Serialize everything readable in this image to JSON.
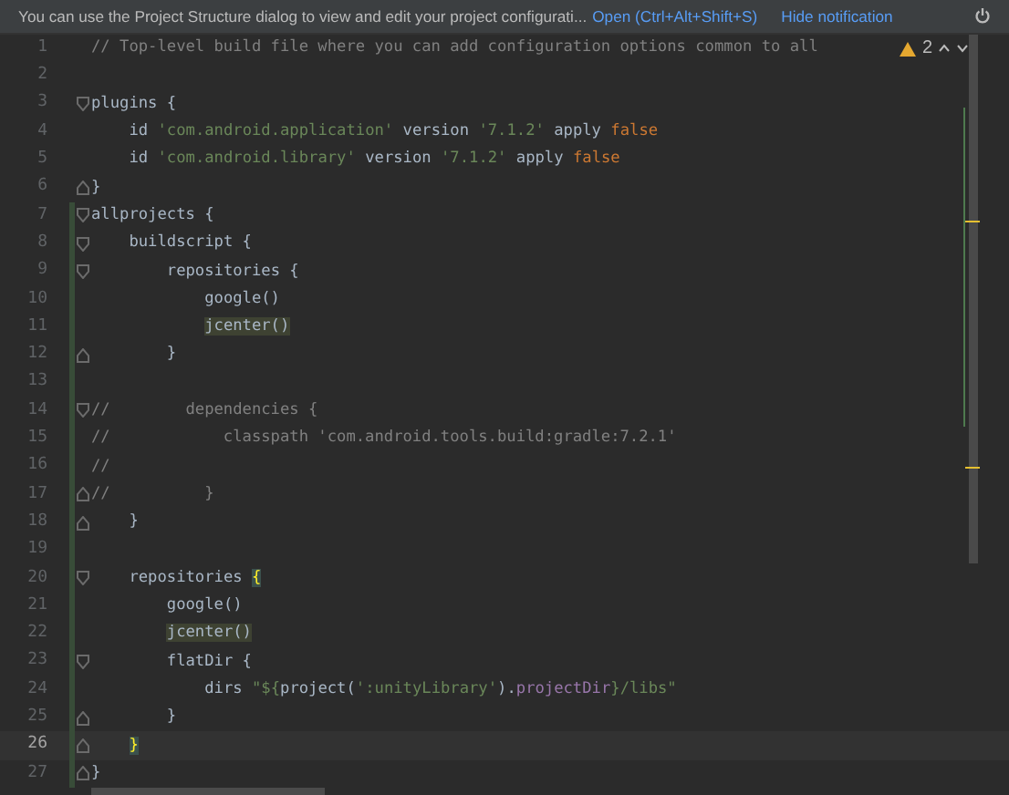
{
  "notification": {
    "text": "You can use the Project Structure dialog to view and edit your project configurati...",
    "actions": [
      {
        "label": "Open (Ctrl+Alt+Shift+S)"
      },
      {
        "label": "Hide notification"
      }
    ]
  },
  "inspections": {
    "count": "2"
  },
  "lines": [
    {
      "number": "1",
      "changed": false,
      "current": false,
      "fold_start": false,
      "fold_end": false,
      "tokens": [
        {
          "text": "// Top-level build file where you can add configuration options common to all",
          "kind": "comment"
        }
      ]
    },
    {
      "number": "2",
      "changed": false,
      "current": false,
      "fold_start": false,
      "fold_end": false
    },
    {
      "number": "3",
      "changed": false,
      "current": false,
      "fold_start": true,
      "fold_end": false,
      "tokens": [
        {
          "text": "plugins {",
          "kind": "plain"
        }
      ]
    },
    {
      "number": "4",
      "changed": false,
      "current": false,
      "fold_start": false,
      "fold_end": false,
      "tokens": [
        {
          "text": "    id",
          "kind": "plain"
        },
        {
          "text": " 'com.android.application'",
          "kind": "string"
        },
        {
          "text": " version",
          "kind": "plain"
        },
        {
          "text": " '7.1.2'",
          "kind": "string"
        },
        {
          "text": " apply",
          "kind": "plain"
        },
        {
          "text": " false",
          "kind": "keyword"
        }
      ]
    },
    {
      "number": "5",
      "changed": false,
      "current": false,
      "fold_start": false,
      "fold_end": false,
      "tokens": [
        {
          "text": "    id",
          "kind": "plain"
        },
        {
          "text": " 'com.android.library'",
          "kind": "string"
        },
        {
          "text": " version",
          "kind": "plain"
        },
        {
          "text": " '7.1.2'",
          "kind": "string"
        },
        {
          "text": " apply",
          "kind": "plain"
        },
        {
          "text": " false",
          "kind": "keyword"
        }
      ]
    },
    {
      "number": "6",
      "changed": false,
      "current": false,
      "fold_start": false,
      "fold_end": true,
      "tokens": [
        {
          "text": "}",
          "kind": "plain"
        }
      ]
    },
    {
      "number": "7",
      "changed": true,
      "current": false,
      "fold_start": true,
      "fold_end": false,
      "tokens": [
        {
          "text": "allprojects {",
          "kind": "plain"
        }
      ]
    },
    {
      "number": "8",
      "changed": true,
      "current": false,
      "fold_start": true,
      "fold_end": false,
      "tokens": [
        {
          "text": "    buildscript {",
          "kind": "plain"
        }
      ]
    },
    {
      "number": "9",
      "changed": true,
      "current": false,
      "fold_start": true,
      "fold_end": false,
      "tokens": [
        {
          "text": "        repositories {",
          "kind": "plain"
        }
      ]
    },
    {
      "number": "10",
      "changed": true,
      "current": false,
      "fold_start": false,
      "fold_end": false,
      "tokens": [
        {
          "text": "            google()",
          "kind": "plain"
        }
      ]
    },
    {
      "number": "11",
      "changed": true,
      "current": false,
      "fold_start": false,
      "fold_end": false,
      "tokens": [
        {
          "text": "            jcenter()",
          "kind": "highlight"
        }
      ]
    },
    {
      "number": "12",
      "changed": true,
      "current": false,
      "fold_start": false,
      "fold_end": true,
      "tokens": [
        {
          "text": "        }",
          "kind": "plain"
        }
      ]
    },
    {
      "number": "13",
      "changed": true,
      "current": false,
      "fold_start": false,
      "fold_end": false
    },
    {
      "number": "14",
      "changed": true,
      "current": false,
      "fold_start": true,
      "fold_end": false,
      "tokens": [
        {
          "text": "//        dependencies {",
          "kind": "comment"
        }
      ]
    },
    {
      "number": "15",
      "changed": true,
      "current": false,
      "fold_start": false,
      "fold_end": false,
      "tokens": [
        {
          "text": "//            classpath 'com.android.tools.build:gradle:7.2.1'",
          "kind": "comment"
        }
      ]
    },
    {
      "number": "16",
      "changed": true,
      "current": false,
      "fold_start": false,
      "fold_end": false,
      "tokens": [
        {
          "text": "//",
          "kind": "comment"
        }
      ]
    },
    {
      "number": "17",
      "changed": true,
      "current": false,
      "fold_start": false,
      "fold_end": true,
      "tokens": [
        {
          "text": "//          }",
          "kind": "comment"
        }
      ]
    },
    {
      "number": "18",
      "changed": true,
      "current": false,
      "fold_start": false,
      "fold_end": true,
      "tokens": [
        {
          "text": "    }",
          "kind": "plain"
        }
      ]
    },
    {
      "number": "19",
      "changed": true,
      "current": false,
      "fold_start": false,
      "fold_end": false
    },
    {
      "number": "20",
      "changed": true,
      "current": false,
      "fold_start": true,
      "fold_end": false,
      "tokens": [
        {
          "text": "    repositories ",
          "kind": "plain"
        },
        {
          "text": "{",
          "kind": "brace"
        }
      ]
    },
    {
      "number": "21",
      "changed": true,
      "current": false,
      "fold_start": false,
      "fold_end": false,
      "tokens": [
        {
          "text": "        google()",
          "kind": "plain"
        }
      ]
    },
    {
      "number": "22",
      "changed": true,
      "current": false,
      "fold_start": false,
      "fold_end": false,
      "tokens": [
        {
          "text": "        jcenter()",
          "kind": "highlight"
        }
      ]
    },
    {
      "number": "23",
      "changed": true,
      "current": false,
      "fold_start": true,
      "fold_end": false,
      "tokens": [
        {
          "text": "        flatDir {",
          "kind": "plain"
        }
      ]
    },
    {
      "number": "24",
      "changed": true,
      "current": false,
      "fold_start": false,
      "fold_end": false,
      "tokens": [
        {
          "text": "            dirs",
          "kind": "plain"
        },
        {
          "text": " \"${",
          "kind": "string"
        },
        {
          "text": "project(",
          "kind": "plain"
        },
        {
          "text": "':unityLibrary'",
          "kind": "string"
        },
        {
          "text": ").",
          "kind": "plain"
        },
        {
          "text": "projectDir",
          "kind": "interp"
        },
        {
          "text": "}/libs\"",
          "kind": "string"
        }
      ]
    },
    {
      "number": "25",
      "changed": true,
      "current": false,
      "fold_start": false,
      "fold_end": true,
      "tokens": [
        {
          "text": "        }",
          "kind": "plain"
        }
      ]
    },
    {
      "number": "26",
      "changed": true,
      "current": true,
      "fold_start": false,
      "fold_end": true,
      "tokens": [
        {
          "text": "    }",
          "kind": "brace"
        }
      ]
    },
    {
      "number": "27",
      "changed": true,
      "current": false,
      "fold_start": false,
      "fold_end": true,
      "tokens": [
        {
          "text": "}",
          "kind": "plain"
        }
      ]
    }
  ]
}
